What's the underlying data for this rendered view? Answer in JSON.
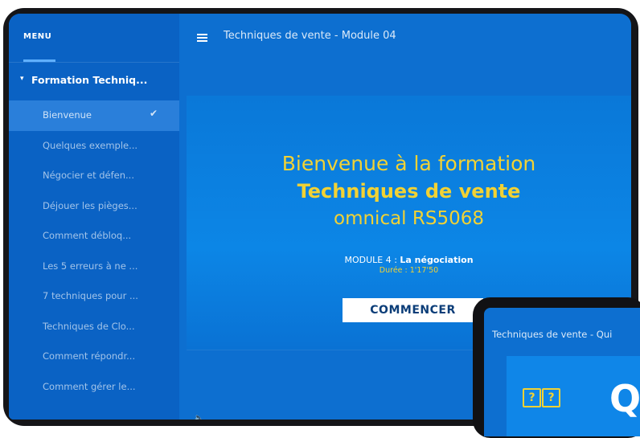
{
  "sidebar": {
    "menu_title": "MENU",
    "section_label": "Formation Techniq...",
    "items": [
      {
        "label": "Bienvenue",
        "completed": true
      },
      {
        "label": "Quelques exemple..."
      },
      {
        "label": "Négocier et défen..."
      },
      {
        "label": "Déjouer les pièges..."
      },
      {
        "label": "Comment débloq..."
      },
      {
        "label": "Les 5 erreurs à ne ..."
      },
      {
        "label": "7 techniques pour ..."
      },
      {
        "label": "Techniques de Clo..."
      },
      {
        "label": "Comment répondr..."
      },
      {
        "label": "Comment gérer le..."
      }
    ]
  },
  "header": {
    "title": "Techniques de vente - Module 04"
  },
  "slide": {
    "line1": "Bienvenue à la formation",
    "line2": "Techniques de vente",
    "line3": "omnical RS5068",
    "module_prefix": "MODULE 4 : ",
    "module_name": "La négociation",
    "duration": "Durée : 1'17'50",
    "start_label": "COMMENCER"
  },
  "tablet": {
    "title": "Techniques de vente - Qui",
    "icon_q1": "?",
    "icon_q2": "?",
    "big_letter": "Q"
  },
  "colors": {
    "accent_yellow": "#f2d234",
    "primary_blue": "#0d6fd0",
    "sidebar_blue": "#0a62c4"
  }
}
